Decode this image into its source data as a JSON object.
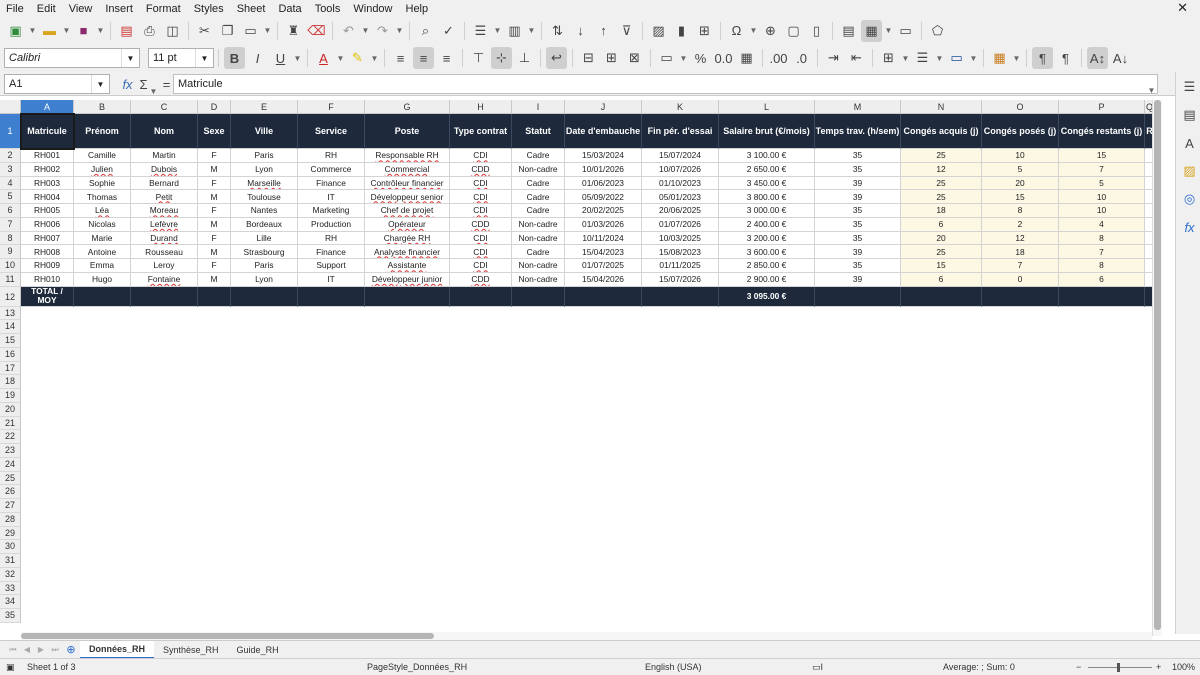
{
  "menu": [
    "File",
    "Edit",
    "View",
    "Insert",
    "Format",
    "Styles",
    "Sheet",
    "Data",
    "Tools",
    "Window",
    "Help"
  ],
  "font": {
    "name": "Calibri",
    "size": "11 pt"
  },
  "namebox": "A1",
  "formula": "Matricule",
  "columns": [
    "A",
    "B",
    "C",
    "D",
    "E",
    "F",
    "G",
    "H",
    "I",
    "J",
    "K",
    "L",
    "M",
    "N",
    "O",
    "P",
    "Q"
  ],
  "headers": [
    "Matricule",
    "Prénom",
    "Nom",
    "Sexe",
    "Ville",
    "Service",
    "Poste",
    "Type contrat",
    "Statut",
    "Date d'embauche",
    "Fin pér. d'essai",
    "Salaire brut (€/mois)",
    "Temps trav. (h/sem)",
    "Congés acquis (j)",
    "Congés posés (j)",
    "Congés restants (j)",
    "R"
  ],
  "rows": [
    [
      "RH001",
      "Camille",
      "Martin",
      "F",
      "Paris",
      "RH",
      "Responsable RH",
      "CDI",
      "Cadre",
      "15/03/2024",
      "15/07/2024",
      "3 100.00 €",
      "35",
      "25",
      "10",
      "15"
    ],
    [
      "RH002",
      "Julien",
      "Dubois",
      "M",
      "Lyon",
      "Commerce",
      "Commercial",
      "CDD",
      "Non-cadre",
      "10/01/2026",
      "10/07/2026",
      "2 650.00 €",
      "35",
      "12",
      "5",
      "7"
    ],
    [
      "RH003",
      "Sophie",
      "Bernard",
      "F",
      "Marseille",
      "Finance",
      "Contrôleur financier",
      "CDI",
      "Cadre",
      "01/06/2023",
      "01/10/2023",
      "3 450.00 €",
      "39",
      "25",
      "20",
      "5"
    ],
    [
      "RH004",
      "Thomas",
      "Petit",
      "M",
      "Toulouse",
      "IT",
      "Développeur senior",
      "CDI",
      "Cadre",
      "05/09/2022",
      "05/01/2023",
      "3 800.00 €",
      "39",
      "25",
      "15",
      "10"
    ],
    [
      "RH005",
      "Léa",
      "Moreau",
      "F",
      "Nantes",
      "Marketing",
      "Chef de projet",
      "CDI",
      "Cadre",
      "20/02/2025",
      "20/06/2025",
      "3 000.00 €",
      "35",
      "18",
      "8",
      "10"
    ],
    [
      "RH006",
      "Nicolas",
      "Lefèvre",
      "M",
      "Bordeaux",
      "Production",
      "Opérateur",
      "CDD",
      "Non-cadre",
      "01/03/2026",
      "01/07/2026",
      "2 400.00 €",
      "35",
      "6",
      "2",
      "4"
    ],
    [
      "RH007",
      "Marie",
      "Durand",
      "F",
      "Lille",
      "RH",
      "Chargée RH",
      "CDI",
      "Non-cadre",
      "10/11/2024",
      "10/03/2025",
      "3 200.00 €",
      "35",
      "20",
      "12",
      "8"
    ],
    [
      "RH008",
      "Antoine",
      "Rousseau",
      "M",
      "Strasbourg",
      "Finance",
      "Analyste financier",
      "CDI",
      "Cadre",
      "15/04/2023",
      "15/08/2023",
      "3 600.00 €",
      "39",
      "25",
      "18",
      "7"
    ],
    [
      "RH009",
      "Emma",
      "Leroy",
      "F",
      "Paris",
      "Support",
      "Assistante",
      "CDI",
      "Non-cadre",
      "01/07/2025",
      "01/11/2025",
      "2 850.00 €",
      "35",
      "15",
      "7",
      "8"
    ],
    [
      "RH010",
      "Hugo",
      "Fontaine",
      "M",
      "Lyon",
      "IT",
      "Développeur junior",
      "CDD",
      "Non-cadre",
      "15/04/2026",
      "15/07/2026",
      "2 900.00 €",
      "39",
      "6",
      "0",
      "6"
    ]
  ],
  "total": {
    "label": "TOTAL / MOY",
    "salary": "3 095.00 €"
  },
  "sheets": [
    "Données_RH",
    "Synthèse_RH",
    "Guide_RH"
  ],
  "status": {
    "sheet": "Sheet 1 of 3",
    "pagestyle": "PageStyle_Données_RH",
    "lang": "English (USA)",
    "summary": "Average: ; Sum: 0",
    "zoom": "100%"
  }
}
